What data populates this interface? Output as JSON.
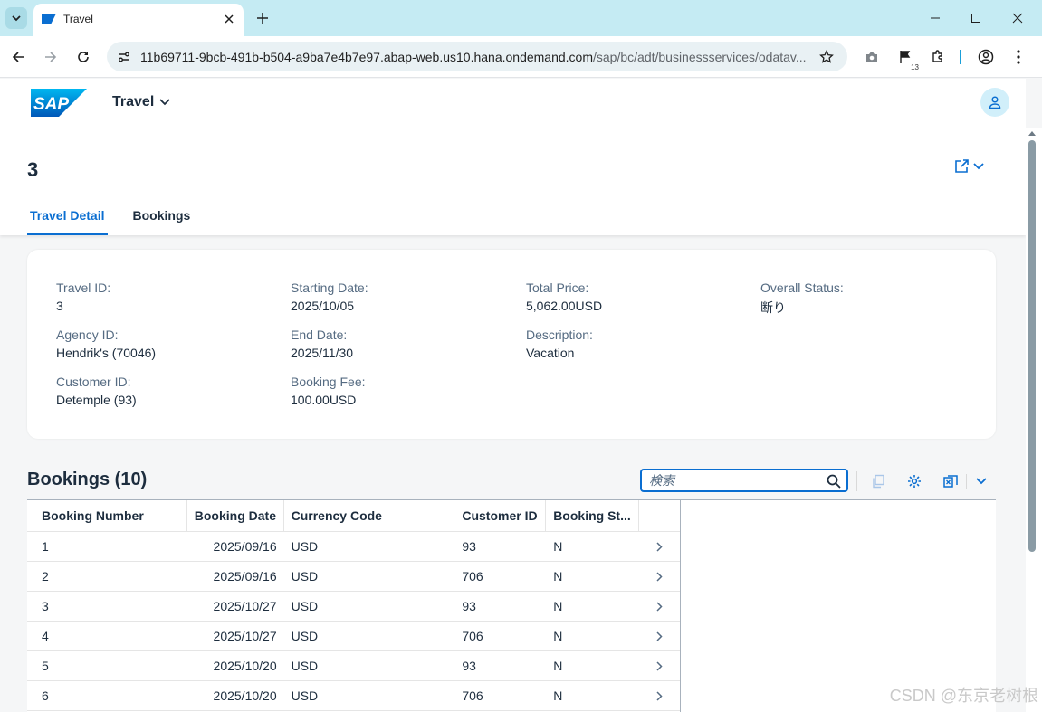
{
  "browser": {
    "tab_title": "Travel",
    "url_host": "11b69711-9bcb-491b-b504-a9ba7e4b7e97.abap-web.us10.hana.ondemand.com",
    "url_path": "/sap/bc/adt/businessservices/odatav...",
    "extension_badge": "13"
  },
  "shell": {
    "logo_text": "SAP",
    "app_title": "Travel"
  },
  "header": {
    "object_title": "3",
    "tabs": [
      {
        "label": "Travel Detail",
        "selected": true
      },
      {
        "label": "Bookings",
        "selected": false
      }
    ]
  },
  "detail": {
    "travel_id": {
      "label": "Travel ID:",
      "value": "3"
    },
    "agency_id": {
      "label": "Agency ID:",
      "value": "Hendrik's (70046)"
    },
    "customer_id": {
      "label": "Customer ID:",
      "value": "Detemple (93)"
    },
    "starting_date": {
      "label": "Starting Date:",
      "value": "2025/10/05"
    },
    "end_date": {
      "label": "End Date:",
      "value": "2025/11/30"
    },
    "booking_fee": {
      "label": "Booking Fee:",
      "value": "100.00USD"
    },
    "total_price": {
      "label": "Total Price:",
      "value": "5,062.00USD"
    },
    "description": {
      "label": "Description:",
      "value": "Vacation"
    },
    "overall_status": {
      "label": "Overall Status:",
      "value": "断り"
    }
  },
  "bookings": {
    "title": "Bookings (10)",
    "search_placeholder": "検索",
    "columns": [
      "Booking Number",
      "Booking Date",
      "Currency Code",
      "Customer ID",
      "Booking St..."
    ],
    "rows": [
      [
        "1",
        "2025/09/16",
        "USD",
        "93",
        "N"
      ],
      [
        "2",
        "2025/09/16",
        "USD",
        "706",
        "N"
      ],
      [
        "3",
        "2025/10/27",
        "USD",
        "93",
        "N"
      ],
      [
        "4",
        "2025/10/27",
        "USD",
        "706",
        "N"
      ],
      [
        "5",
        "2025/10/20",
        "USD",
        "93",
        "N"
      ],
      [
        "6",
        "2025/10/20",
        "USD",
        "706",
        "N"
      ]
    ]
  },
  "watermark": "CSDN @东京老树根",
  "colors": {
    "accent": "#0a6ed1",
    "tabstrip": "#c5ebf3",
    "page_bg": "#f5f6f7",
    "text": "#1d2d3e",
    "label": "#556b82"
  }
}
